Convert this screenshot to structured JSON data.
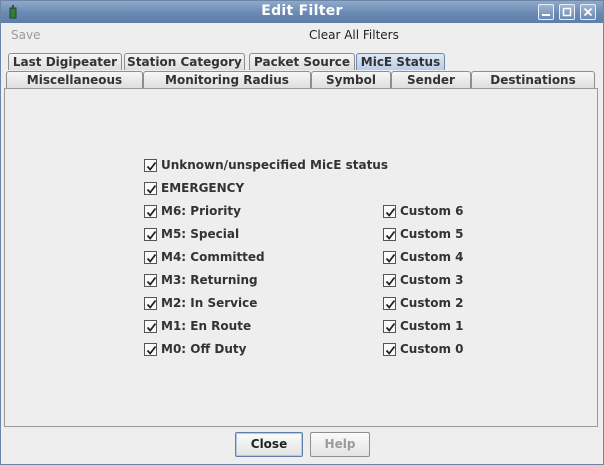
{
  "window": {
    "title": "Edit Filter"
  },
  "menu": {
    "save_label": "Save",
    "clear_label": "Clear All Filters"
  },
  "tabs_row1": [
    {
      "label": "Last Digipeater"
    },
    {
      "label": "Station Category"
    },
    {
      "label": "Packet Source"
    },
    {
      "label": "MicE Status",
      "selected": true
    }
  ],
  "tabs_row2": [
    {
      "label": "Miscellaneous"
    },
    {
      "label": "Monitoring Radius"
    },
    {
      "label": "Symbol"
    },
    {
      "label": "Sender"
    },
    {
      "label": "Destinations"
    }
  ],
  "checkboxes_left": [
    {
      "label": "Unknown/unspecified MicE status",
      "checked": true
    },
    {
      "label": "EMERGENCY",
      "checked": true
    },
    {
      "label": "M6: Priority",
      "checked": true
    },
    {
      "label": "M5: Special",
      "checked": true
    },
    {
      "label": "M4: Committed",
      "checked": true
    },
    {
      "label": "M3: Returning",
      "checked": true
    },
    {
      "label": "M2: In Service",
      "checked": true
    },
    {
      "label": "M1: En Route",
      "checked": true
    },
    {
      "label": "M0: Off Duty",
      "checked": true
    }
  ],
  "checkboxes_right": [
    {
      "label": "Custom 6",
      "checked": true
    },
    {
      "label": "Custom 5",
      "checked": true
    },
    {
      "label": "Custom 4",
      "checked": true
    },
    {
      "label": "Custom 3",
      "checked": true
    },
    {
      "label": "Custom 2",
      "checked": true
    },
    {
      "label": "Custom 1",
      "checked": true
    },
    {
      "label": "Custom 0",
      "checked": true
    }
  ],
  "buttons": {
    "close_label": "Close",
    "help_label": "Help"
  },
  "colors": {
    "titlebar": "#6a89b3",
    "selected_tab": "#b8cde6",
    "panel_bg": "#eeeeee"
  }
}
